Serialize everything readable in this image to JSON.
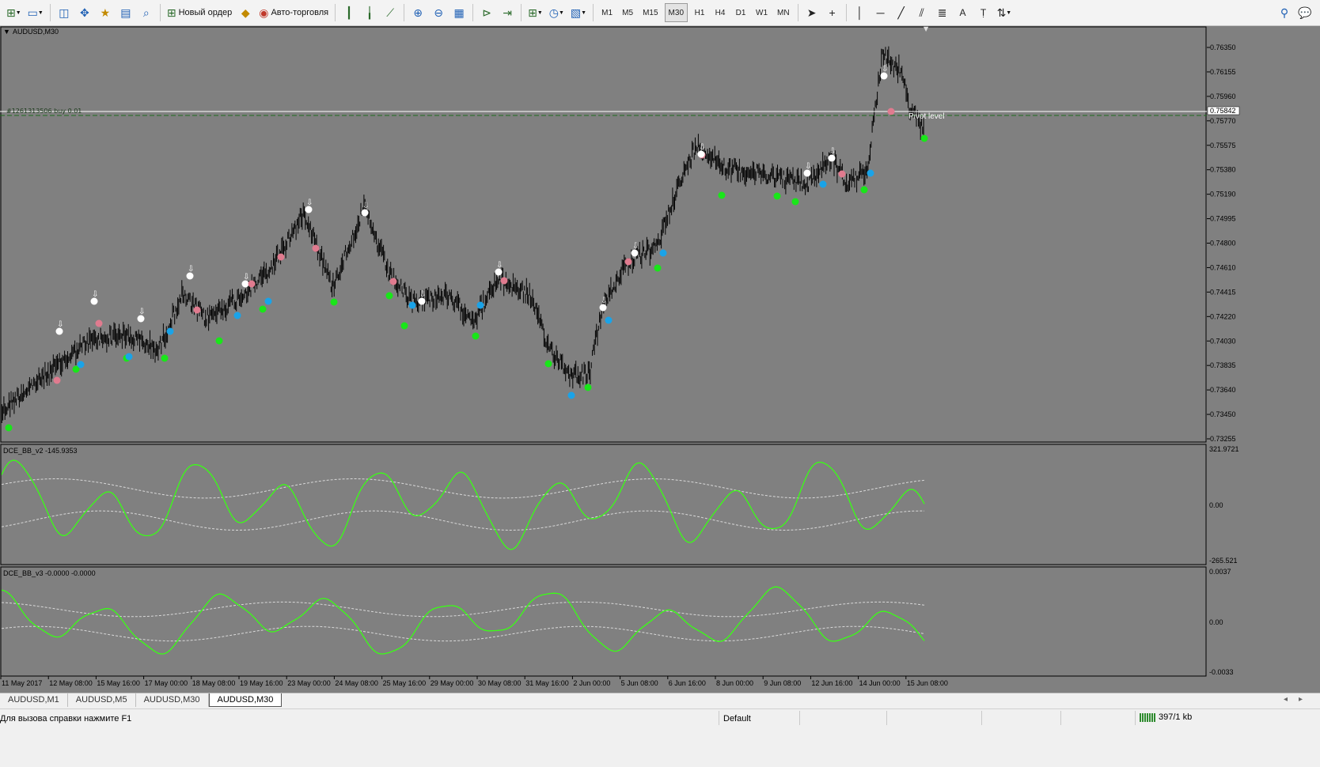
{
  "toolbar": {
    "new_order_label": "Новый ордер",
    "auto_trading_label": "Авто-торговля",
    "timeframes": [
      "M1",
      "M5",
      "M15",
      "M30",
      "H1",
      "H4",
      "D1",
      "W1",
      "MN"
    ],
    "active_timeframe": "M30"
  },
  "chart": {
    "title": "AUDUSD,M30",
    "order_line_label": "#1261313506 buy 0.01",
    "pivot_label": "Pivot level",
    "current_price": "0.75842",
    "price_labels": [
      "0.76350",
      "0.76155",
      "0.75960",
      "0.75770",
      "0.75575",
      "0.75380",
      "0.75190",
      "0.74995",
      "0.74800",
      "0.74610",
      "0.74415",
      "0.74220",
      "0.74030",
      "0.73835",
      "0.73640",
      "0.73450",
      "0.73255"
    ],
    "time_labels": [
      "11 May 2017",
      "12 May 08:00",
      "15 May 16:00",
      "17 May 00:00",
      "18 May 08:00",
      "19 May 16:00",
      "23 May 00:00",
      "24 May 08:00",
      "25 May 16:00",
      "29 May 00:00",
      "30 May 08:00",
      "31 May 16:00",
      "2 Jun 00:00",
      "5 Jun 08:00",
      "6 Jun 16:00",
      "8 Jun 00:00",
      "9 Jun 08:00",
      "12 Jun 16:00",
      "14 Jun 00:00",
      "15 Jun 08:00"
    ],
    "indicator1": {
      "label": "DCE_BB_v2 -145.9353",
      "scale": [
        "321.9721",
        "0.00",
        "-265.521"
      ]
    },
    "indicator2": {
      "label": "DCE_BB_v3 -0.0000 -0.0000",
      "scale": [
        "0.0037",
        "0.00",
        "-0.0033"
      ]
    },
    "colors": {
      "background": "#808080",
      "candles": "#000000",
      "signal_line": "#39ff14",
      "band_line": "#d9d9d9",
      "marker_green": "#19e619",
      "marker_blue": "#1aa3e8",
      "marker_pink": "#e07b8f",
      "marker_white": "#ffffff"
    }
  },
  "tabs": [
    {
      "label": "AUDUSD,M1",
      "active": false
    },
    {
      "label": "AUDUSD,M5",
      "active": false
    },
    {
      "label": "AUDUSD,M30",
      "active": false
    },
    {
      "label": "AUDUSD,M30",
      "active": true
    }
  ],
  "status": {
    "help_text": "Для вызова справки нажмите F1",
    "profile": "Default",
    "traffic": "397/1 kb"
  }
}
